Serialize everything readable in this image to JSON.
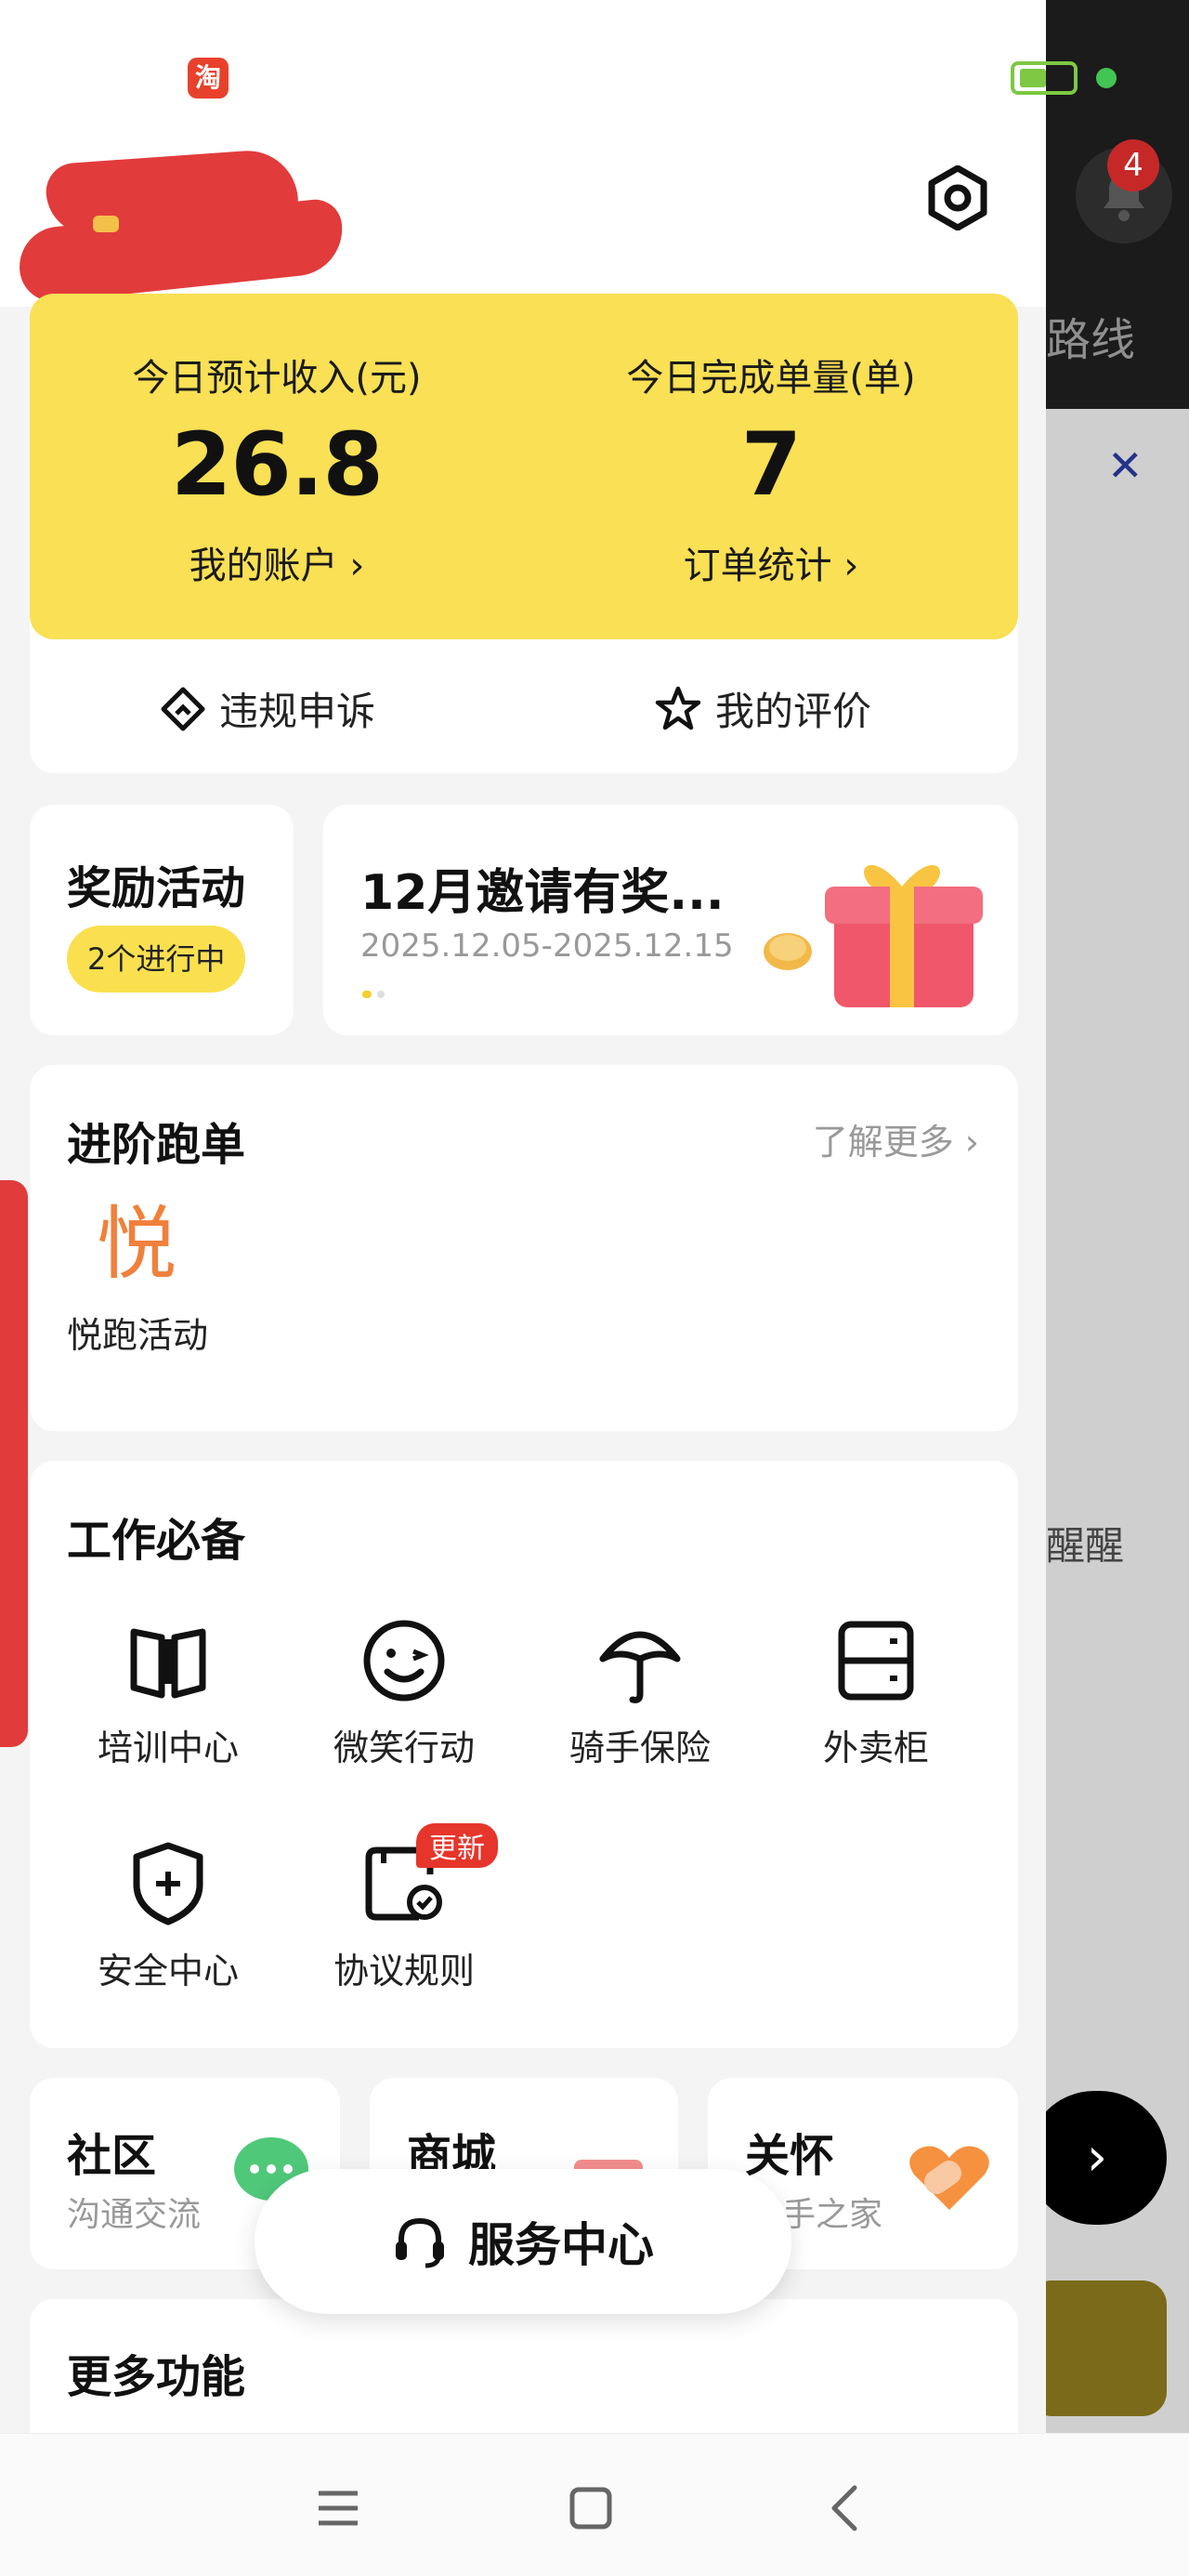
{
  "background_app": {
    "notification_count": "4",
    "route_label": "路线",
    "reminder_label": "醒醒"
  },
  "header": {
    "status_app_icon": "淘"
  },
  "income": {
    "today_income_label": "今日预计收入(元)",
    "today_income_value": "26.8",
    "account_link": "我的账户 ›",
    "today_orders_label": "今日完成单量(单)",
    "today_orders_value": "7",
    "orders_link": "订单统计 ›"
  },
  "quick_links": {
    "appeal": "违规申诉",
    "reviews": "我的评价"
  },
  "rewards": {
    "title": "奖励活动",
    "count_label": "2个进行中"
  },
  "promo": {
    "title": "12月邀请有奖...",
    "date_range": "2025.12.05-2025.12.15"
  },
  "advanced": {
    "title": "进阶跑单",
    "more_link": "了解更多 ›",
    "item_icon_char": "悦",
    "item_label": "悦跑活动"
  },
  "work_essentials": {
    "title": "工作必备",
    "items": [
      {
        "label": "培训中心",
        "icon": "book-icon"
      },
      {
        "label": "微笑行动",
        "icon": "smile-icon"
      },
      {
        "label": "骑手保险",
        "icon": "umbrella-icon"
      },
      {
        "label": "外卖柜",
        "icon": "locker-icon"
      },
      {
        "label": "安全中心",
        "icon": "shield-plus-icon"
      },
      {
        "label": "协议规则",
        "icon": "agreement-icon",
        "badge": "更新"
      }
    ]
  },
  "mini_cards": [
    {
      "title": "社区",
      "subtitle": "沟通交流"
    },
    {
      "title": "商城",
      "subtitle": ""
    },
    {
      "title": "关怀",
      "subtitle": "手之家"
    }
  ],
  "service_center": {
    "label": "服务中心"
  },
  "more_functions": {
    "title": "更多功能"
  },
  "colors": {
    "accent_yellow": "#F9E054",
    "badge_red": "#E6352B",
    "advanced_icon_orange": "#F0803C"
  }
}
